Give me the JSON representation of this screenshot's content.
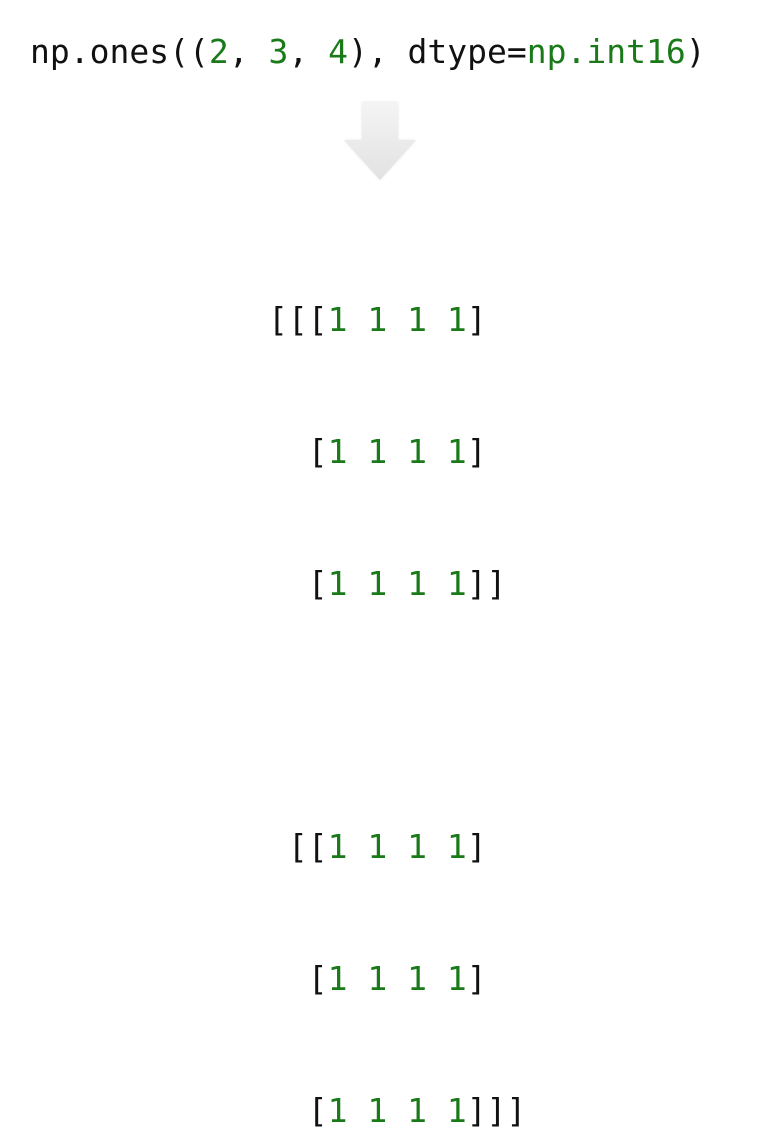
{
  "expression": {
    "func": "np.ones(",
    "open_tuple": "(",
    "dim0": "2",
    "sep0": ", ",
    "dim1": "3",
    "sep1": ", ",
    "dim2": "4",
    "close_tuple": "), dtype=",
    "dtype": "np.int16",
    "close_call": ")"
  },
  "arrow_icon": "down-arrow-icon",
  "colors": {
    "code": "#111111",
    "values": "#1a7a1a",
    "arrow": "#e6e6e6"
  },
  "result": {
    "blocks": [
      {
        "rows": [
          {
            "prefix": "[[[",
            "values": "1 1 1 1",
            "suffix": "]"
          },
          {
            "prefix": "  [",
            "values": "1 1 1 1",
            "suffix": "]"
          },
          {
            "prefix": "  [",
            "values": "1 1 1 1",
            "suffix": "]]"
          }
        ]
      },
      {
        "rows": [
          {
            "prefix": " [[",
            "values": "1 1 1 1",
            "suffix": "]"
          },
          {
            "prefix": "  [",
            "values": "1 1 1 1",
            "suffix": "]"
          },
          {
            "prefix": "  [",
            "values": "1 1 1 1",
            "suffix": "]]]"
          }
        ]
      }
    ]
  }
}
